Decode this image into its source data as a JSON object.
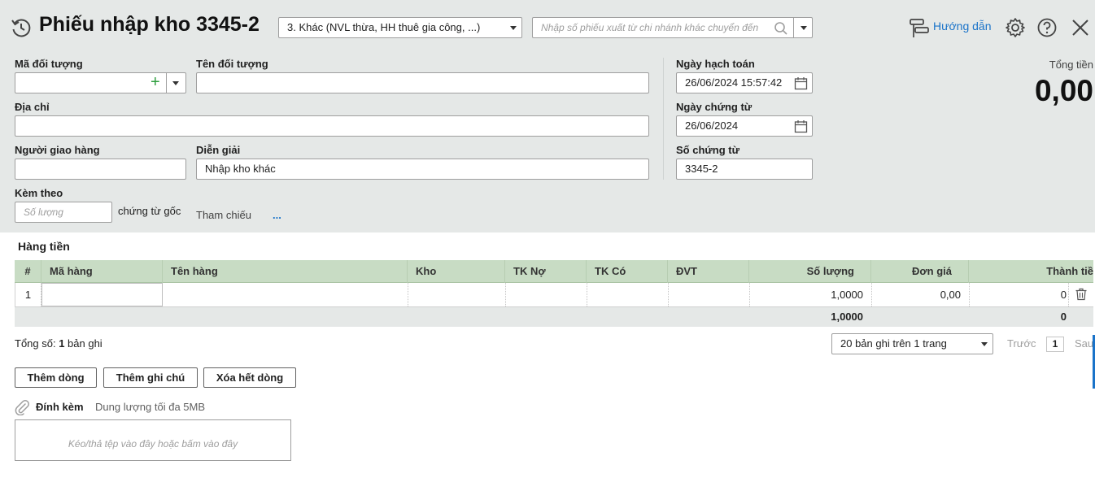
{
  "header": {
    "title": "Phiếu nhập kho 3345-2",
    "type_select": "3. Khác (NVL thừa, HH thuê gia công, ...)",
    "search_placeholder": "Nhập số phiếu xuất từ chi nhánh khác chuyển đến",
    "guide_label": "Hướng dẫn"
  },
  "form": {
    "ma_doi_tuong_label": "Mã đối tượng",
    "ma_doi_tuong_value": "",
    "ten_doi_tuong_label": "Tên đối tượng",
    "ten_doi_tuong_value": "",
    "dia_chi_label": "Địa chỉ",
    "dia_chi_value": "",
    "nguoi_giao_hang_label": "Người giao hàng",
    "nguoi_giao_hang_value": "",
    "dien_giai_label": "Diễn giải",
    "dien_giai_value": "Nhập kho khác",
    "kem_theo_label": "Kèm theo",
    "so_luong_placeholder": "Số lượng",
    "chung_tu_goc_label": "chứng từ gốc",
    "tham_chieu_label": "Tham chiếu",
    "tham_chieu_more": "...",
    "ngay_hach_toan_label": "Ngày hạch toán",
    "ngay_hach_toan_value": "26/06/2024 15:57:42",
    "ngay_chung_tu_label": "Ngày chứng từ",
    "ngay_chung_tu_value": "26/06/2024",
    "so_chung_tu_label": "Số chứng từ",
    "so_chung_tu_value": "3345-2"
  },
  "total": {
    "label": "Tổng tiền",
    "value": "0,00"
  },
  "grid": {
    "section_title": "Hàng tiền",
    "columns": [
      "#",
      "Mã hàng",
      "Tên hàng",
      "Kho",
      "TK Nợ",
      "TK Có",
      "ĐVT",
      "Số lượng",
      "Đơn giá",
      "Thành tiề"
    ],
    "rows": [
      {
        "no": "1",
        "ma_hang": "",
        "ten_hang": "",
        "kho": "",
        "tk_no": "",
        "tk_co": "",
        "dvt": "",
        "so_luong": "1,0000",
        "don_gia": "0,00",
        "thanh_tien": "0"
      }
    ],
    "sum": {
      "so_luong": "1,0000",
      "thanh_tien": "0"
    }
  },
  "pager": {
    "total_prefix": "Tổng số: ",
    "total_count": "1",
    "total_suffix": " bản ghi",
    "page_size": "20 bản ghi trên 1 trang",
    "prev": "Trước",
    "page": "1",
    "next": "Sau"
  },
  "actions": {
    "add_row": "Thêm dòng",
    "add_note": "Thêm ghi chú",
    "delete_all": "Xóa hết dòng"
  },
  "attachment": {
    "label": "Đính kèm",
    "limit": "Dung lượng tối đa 5MB",
    "dropzone": "Kéo/thả tệp vào đây hoặc bấm vào đây"
  },
  "colors": {
    "panel_bg": "#e5e8e7",
    "grid_header": "#c8dcc4",
    "accent_blue": "#1a73c9",
    "add_green": "#2e9e3e"
  }
}
